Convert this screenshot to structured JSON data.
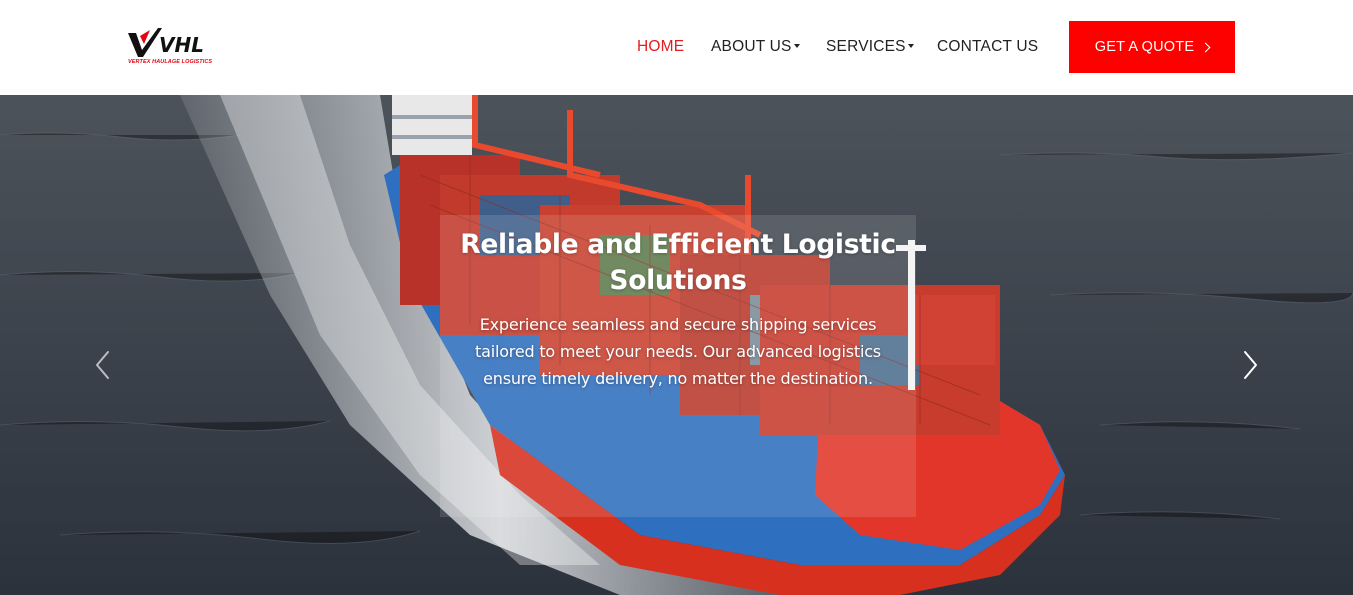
{
  "brand": {
    "logo_mark": "VHL",
    "logo_tagline": "VERTEX HAULAGE LOGISTICS",
    "accent_color": "#fd0000"
  },
  "nav": {
    "items": [
      {
        "label": "HOME",
        "active": true,
        "has_dropdown": false
      },
      {
        "label": "ABOUT US",
        "active": false,
        "has_dropdown": true
      },
      {
        "label": "SERVICES",
        "active": false,
        "has_dropdown": true
      },
      {
        "label": "CONTACT US",
        "active": false,
        "has_dropdown": false
      }
    ],
    "cta_label": "GET A QUOTE",
    "cta_icon": "chevron-right-icon"
  },
  "hero": {
    "title": "Reliable and Efficient Logistic Solutions",
    "text": "Experience seamless and secure shipping services tailored to meet your needs. Our advanced logistics ensure timely delivery, no matter the destination.",
    "prev_icon": "chevron-left-icon",
    "next_icon": "chevron-right-icon"
  }
}
